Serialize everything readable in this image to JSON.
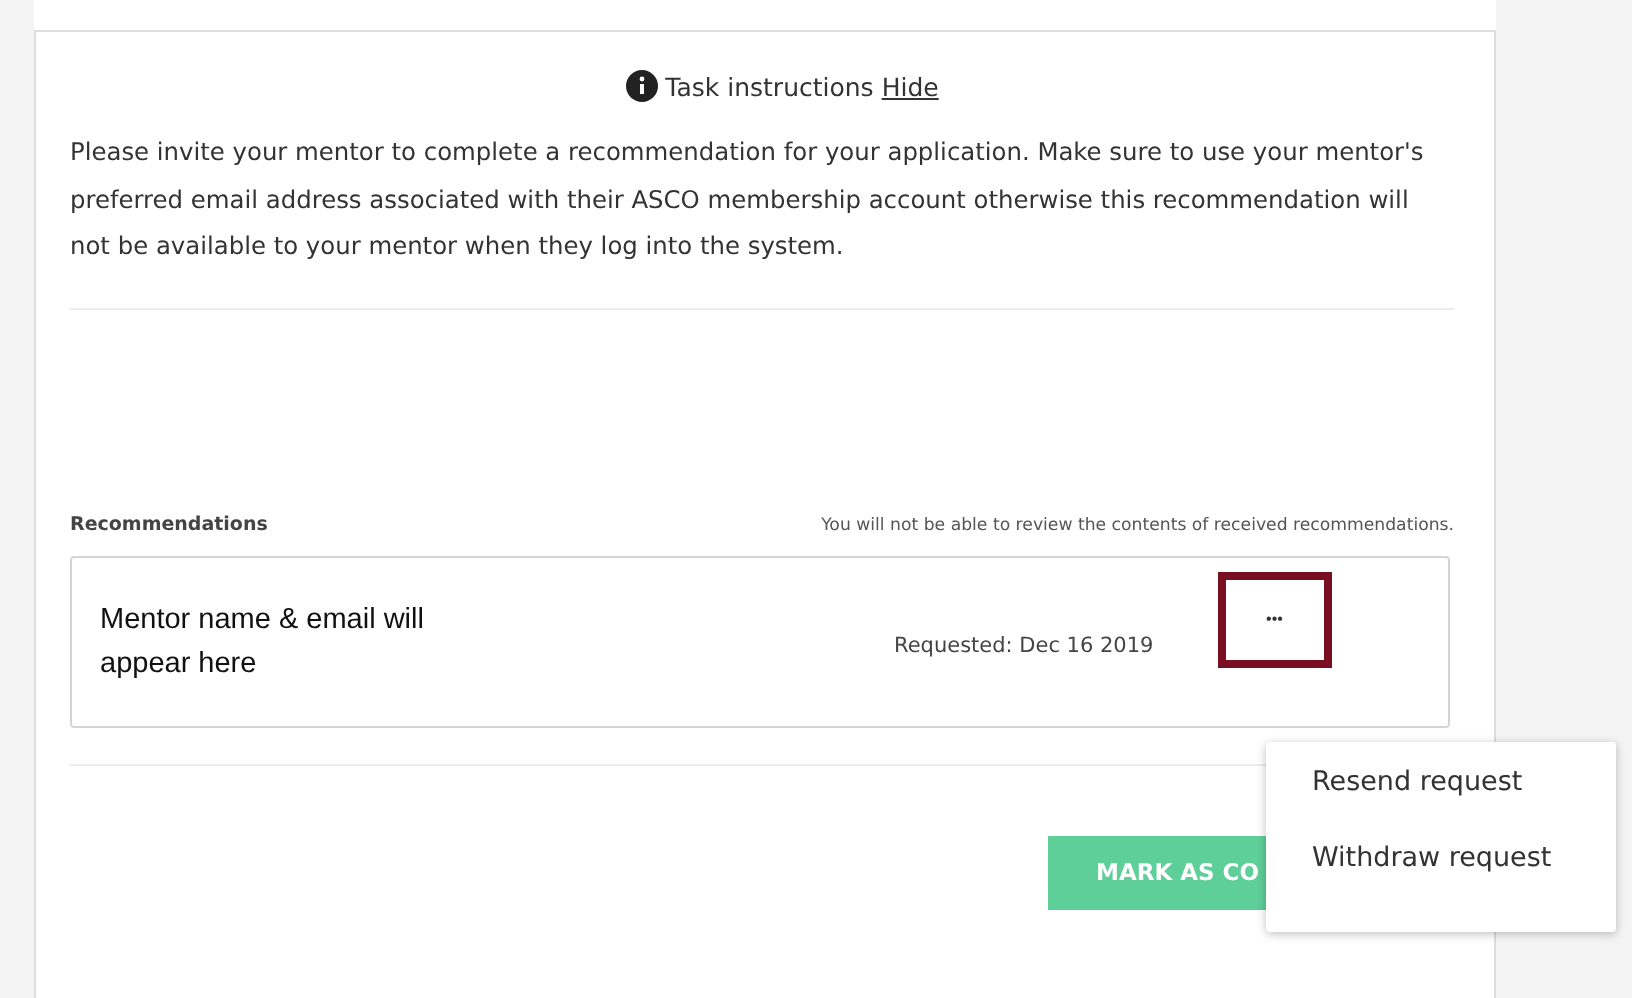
{
  "instructions": {
    "label": "Task instructions",
    "toggle": "Hide",
    "text": "Please invite your mentor to complete a recommendation for your application. Make sure to use your mentor's preferred email address associated with their ASCO membership account otherwise this recommendation will not be available to your mentor when they log into the system."
  },
  "recommendations": {
    "heading": "Recommendations",
    "note": "You will not be able to review the contents of received recommendations.",
    "items": [
      {
        "mentor": "Mentor name & email will appear here",
        "requested": "Requested: Dec 16 2019",
        "more": "•••",
        "highlighted": true
      }
    ]
  },
  "menu": {
    "open": true,
    "items": [
      {
        "label": "Resend request"
      },
      {
        "label": "Withdraw request"
      }
    ]
  },
  "complete_button": {
    "label": "MARK AS CO",
    "disabled": true
  }
}
